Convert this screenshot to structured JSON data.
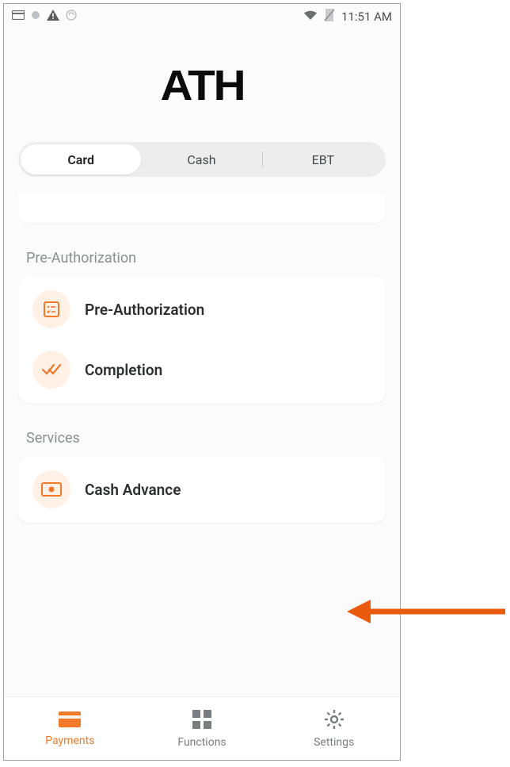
{
  "status": {
    "time": "11:51 AM"
  },
  "logo": {
    "text": "ATH"
  },
  "tabs": {
    "items": [
      "Card",
      "Cash",
      "EBT"
    ],
    "active": 0
  },
  "sections": {
    "preauth": {
      "title": "Pre-Authorization",
      "items": [
        {
          "label": "Pre-Authorization",
          "icon": "checklist-icon"
        },
        {
          "label": "Completion",
          "icon": "double-check-icon"
        }
      ]
    },
    "services": {
      "title": "Services",
      "items": [
        {
          "label": "Cash Advance",
          "icon": "cash-icon"
        }
      ]
    }
  },
  "bottomNav": {
    "items": [
      {
        "label": "Payments",
        "icon": "card-icon"
      },
      {
        "label": "Functions",
        "icon": "grid-icon"
      },
      {
        "label": "Settings",
        "icon": "gear-icon"
      }
    ],
    "active": 0
  },
  "colors": {
    "accent": "#f07a2a"
  }
}
